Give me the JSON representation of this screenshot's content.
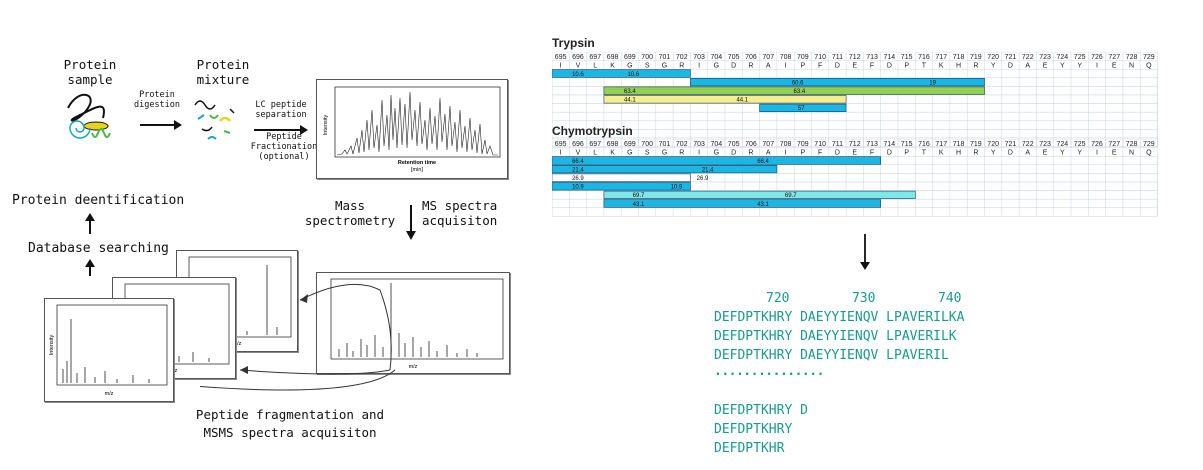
{
  "left": {
    "protein_sample": "Protein sample",
    "protein_mixture": "Protein mixture",
    "protein_digestion": "Protein digestion",
    "lc_separation": "LC peptide separation",
    "fractionation": "Peptide Fractionation (optional)",
    "mass_spectrometry": "Mass spectrometry",
    "ms_acquisition": "MS spectra acquisiton",
    "protein_identification": "Protein deentification",
    "database_searching": "Database searching",
    "fragmentation": "Peptide fragmentation and MSMS spectra acquisiton",
    "chrom_ylabel": "Intensity",
    "chrom_xlabel": "Retention time",
    "chrom_xunit": "[min]",
    "ms_ylabel": "Intensity",
    "ms_xlabel": "m/z"
  },
  "trypsin": {
    "title": "Trypsin",
    "positions": [
      "695",
      "696",
      "697",
      "698",
      "699",
      "700",
      "701",
      "702",
      "703",
      "704",
      "705",
      "706",
      "707",
      "708",
      "709",
      "710",
      "711",
      "712",
      "713",
      "714",
      "715",
      "716",
      "717",
      "718",
      "719",
      "720",
      "721",
      "722",
      "723",
      "724",
      "725",
      "726",
      "727",
      "728",
      "729"
    ],
    "residues": [
      "I",
      "V",
      "L",
      "K",
      "G",
      "S",
      "G",
      "R",
      "I",
      "G",
      "D",
      "R",
      "A",
      "I",
      "P",
      "F",
      "D",
      "E",
      "F",
      "D",
      "P",
      "T",
      "K",
      "H",
      "R",
      "Y",
      "D",
      "A",
      "E",
      "Y",
      "Y",
      "I",
      "E",
      "N",
      "Q"
    ],
    "bars": [
      {
        "start": 0,
        "end": 8,
        "color": "#19b8e4",
        "labels": [
          {
            "at": 1.5,
            "text": "10.6"
          },
          {
            "at": 4.7,
            "text": "10.6"
          }
        ]
      },
      {
        "start": 8,
        "end": 25,
        "color": "#19b8e4",
        "labels": [
          {
            "at": 14.2,
            "text": "60.6"
          },
          {
            "at": 22,
            "text": "19"
          }
        ]
      },
      {
        "start": 3,
        "end": 25,
        "color": "#92d050",
        "labels": [
          {
            "at": 4.5,
            "text": "63.4"
          },
          {
            "at": 14.3,
            "text": "63.4"
          }
        ]
      },
      {
        "start": 3,
        "end": 17,
        "color": "#f4ee8c",
        "labels": [
          {
            "at": 4.5,
            "text": "44.1"
          },
          {
            "at": 11,
            "text": "44.1"
          }
        ]
      },
      {
        "start": 12,
        "end": 17,
        "color": "#19b8e4",
        "labels": [
          {
            "at": 14.4,
            "text": "57"
          }
        ]
      }
    ]
  },
  "chymotrypsin": {
    "title": "Chymotrypsin",
    "positions": [
      "695",
      "696",
      "697",
      "698",
      "699",
      "700",
      "701",
      "702",
      "703",
      "704",
      "705",
      "706",
      "707",
      "708",
      "709",
      "710",
      "711",
      "712",
      "713",
      "714",
      "715",
      "716",
      "717",
      "718",
      "719",
      "720",
      "721",
      "722",
      "723",
      "724",
      "725",
      "726",
      "727",
      "728",
      "729"
    ],
    "residues": [
      "I",
      "V",
      "L",
      "K",
      "G",
      "S",
      "G",
      "R",
      "I",
      "G",
      "D",
      "R",
      "A",
      "I",
      "P",
      "F",
      "D",
      "E",
      "F",
      "D",
      "P",
      "T",
      "K",
      "H",
      "R",
      "Y",
      "D",
      "A",
      "E",
      "Y",
      "Y",
      "I",
      "E",
      "N",
      "Q"
    ],
    "bars": [
      {
        "start": 0,
        "end": 19,
        "color": "#19b8e4",
        "labels": [
          {
            "at": 1.5,
            "text": "66.4"
          },
          {
            "at": 12.2,
            "text": "66.4"
          }
        ]
      },
      {
        "start": 0,
        "end": 13,
        "color": "#19b8e4",
        "labels": [
          {
            "at": 1.5,
            "text": "21.4"
          },
          {
            "at": 9,
            "text": "21.4"
          }
        ]
      },
      {
        "start": 0,
        "end": 8,
        "color": "#ffffff",
        "labels": [
          {
            "at": 1.5,
            "text": "26.9"
          },
          {
            "at": 8.7,
            "text": "26.9"
          }
        ]
      },
      {
        "start": 0,
        "end": 8,
        "color": "#19b8e4",
        "labels": [
          {
            "at": 1.5,
            "text": "10.9"
          },
          {
            "at": 7.2,
            "text": "10.9"
          }
        ]
      },
      {
        "start": 3,
        "end": 21,
        "color": "#7ee8e8",
        "labels": [
          {
            "at": 5,
            "text": "69.7"
          },
          {
            "at": 13.8,
            "text": "69.7"
          }
        ]
      },
      {
        "start": 3,
        "end": 19,
        "color": "#19b8e4",
        "labels": [
          {
            "at": 5,
            "text": "43.1"
          },
          {
            "at": 12.2,
            "text": "43.1"
          }
        ]
      }
    ]
  },
  "alignment": {
    "ruler": [
      "720",
      "730",
      "740"
    ],
    "rows": [
      "DEFDPTKHRY DAEYYIENQV LPAVERILKA",
      "DEFDPTKHRY DAEYYIENQV LPAVERILK",
      "DEFDPTKHRY DAEYYIENQV LPAVERIL"
    ],
    "ellipsis": "...............",
    "rows2": [
      "DEFDPTKHRY D",
      "DEFDPTKHRY",
      "DEFDPTKHR"
    ]
  }
}
